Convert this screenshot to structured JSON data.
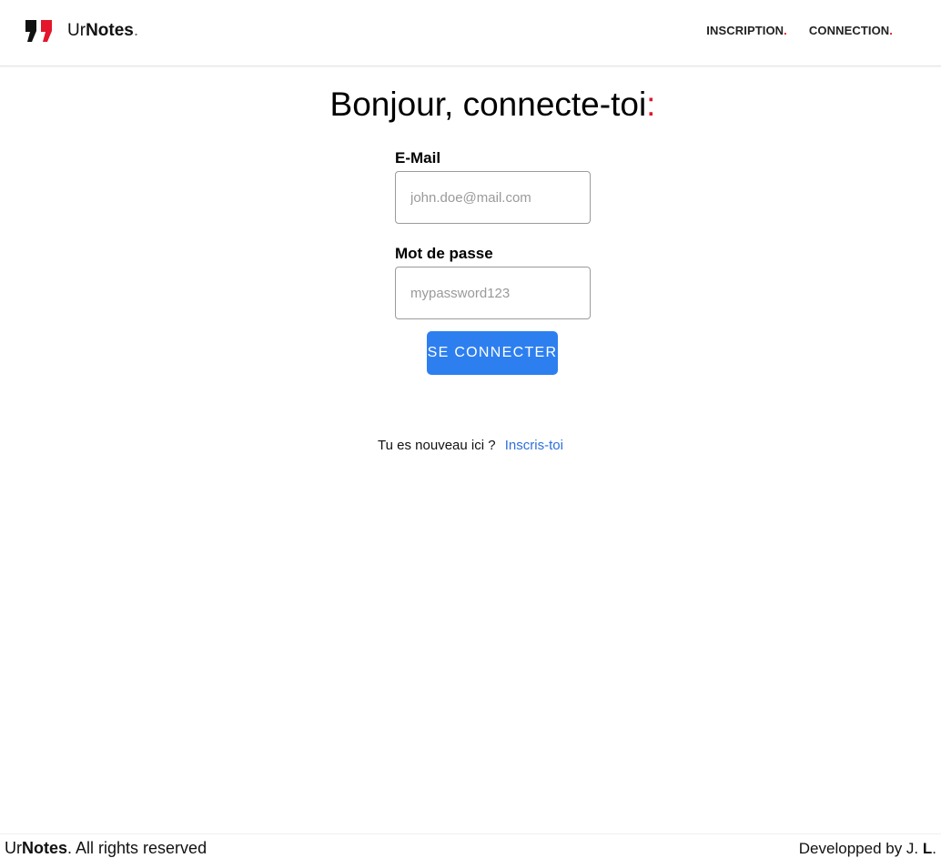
{
  "header": {
    "brand": {
      "prefix": "Ur",
      "bold": "Notes",
      "dot": "."
    },
    "nav": [
      {
        "label": "INSCRIPTION",
        "dot": "."
      },
      {
        "label": "CONNECTION",
        "dot": "."
      }
    ]
  },
  "main": {
    "title": "Bonjour, connecte-toi",
    "title_colon": ":",
    "form": {
      "email_label": "E-Mail",
      "email_placeholder": "john.doe@mail.com",
      "password_label": "Mot de passe",
      "password_placeholder": "mypassword123",
      "submit_label": "SE CONNECTER"
    },
    "signup": {
      "prompt": "Tu es nouveau ici ?",
      "link": "Inscris-toi"
    }
  },
  "footer": {
    "left_prefix": "Ur",
    "left_bold": "Notes",
    "left_rest": ". All rights reserved",
    "right_prefix": "Developped by J. ",
    "right_bold": "L",
    "right_dot": "."
  },
  "colors": {
    "accent": "#2d7ff0",
    "brand_red": "#e3162b",
    "link": "#2d6fdc"
  },
  "icons": {
    "brand": "quote-mark-icon"
  }
}
